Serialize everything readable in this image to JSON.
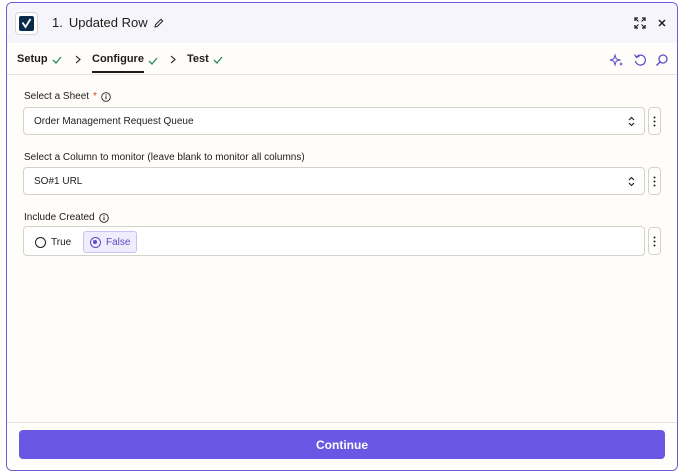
{
  "header": {
    "step_number": "1.",
    "title": "Updated Row"
  },
  "tabs": [
    {
      "label": "Setup",
      "complete": true
    },
    {
      "label": "Configure",
      "complete": true
    },
    {
      "label": "Test",
      "complete": true
    }
  ],
  "fields": {
    "sheet": {
      "label": "Select a Sheet",
      "required_mark": "*",
      "value": "Order Management Request Queue"
    },
    "column": {
      "label": "Select a Column to monitor (leave blank to monitor all columns)",
      "value": "SO#1 URL"
    },
    "include_created": {
      "label": "Include Created",
      "options": [
        "True",
        "False"
      ],
      "selected": "False"
    }
  },
  "footer": {
    "continue_label": "Continue"
  },
  "colors": {
    "accent": "#6a57e3",
    "check": "#2e8b57",
    "required": "#d2462e"
  }
}
